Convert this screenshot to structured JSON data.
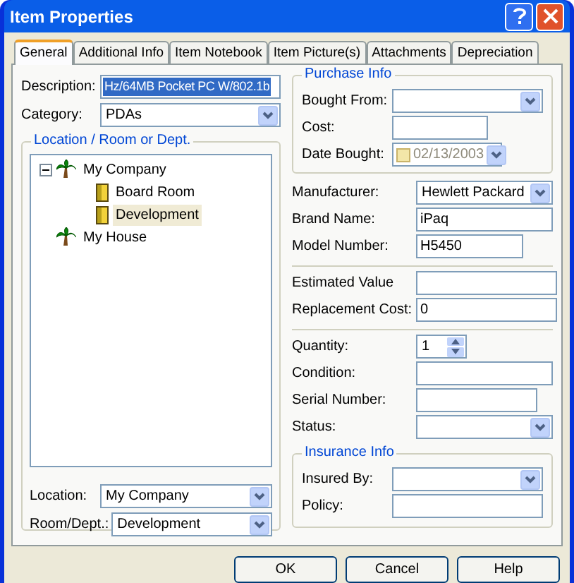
{
  "window": {
    "title": "Item Properties"
  },
  "tabs": [
    {
      "label": "General",
      "selected": true
    },
    {
      "label": "Additional Info",
      "selected": false
    },
    {
      "label": "Item Notebook",
      "selected": false
    },
    {
      "label": "Item Picture(s)",
      "selected": false
    },
    {
      "label": "Attachments",
      "selected": false
    },
    {
      "label": "Depreciation",
      "selected": false
    }
  ],
  "general": {
    "top_fields": [
      {
        "label": "Description:",
        "kind": "text",
        "value": "Hz/64MB Pocket PC W/802.1b",
        "selected": true
      },
      {
        "label": "Category:",
        "kind": "combo",
        "value": "PDAs"
      }
    ],
    "location_group": {
      "title": "Location / Room or Dept.",
      "tree": [
        {
          "label": "My Company",
          "kind": "site",
          "expanded": true,
          "selected": false,
          "children": [
            {
              "label": "Board Room",
              "kind": "room",
              "selected": false
            },
            {
              "label": "Development",
              "kind": "room",
              "selected": true
            }
          ]
        },
        {
          "label": "My House",
          "kind": "site",
          "selected": false
        }
      ],
      "fields": [
        {
          "label": "Location:",
          "kind": "combo",
          "value": "My Company"
        },
        {
          "label": "Room/Dept.:",
          "kind": "combo",
          "value": "Development"
        }
      ]
    },
    "purchase_info": {
      "title": "Purchase Info",
      "fields": [
        {
          "label": "Bought From:",
          "kind": "combo"
        },
        {
          "label": "Cost:",
          "kind": "text"
        },
        {
          "label": "Date Bought:",
          "kind": "date",
          "value": "02/13/2003",
          "disabled": true
        }
      ]
    },
    "sections": [
      [
        {
          "label": "Manufacturer:",
          "kind": "combo",
          "value": "Hewlett Packard"
        },
        {
          "label": "Brand Name:",
          "kind": "text",
          "value": "iPaq"
        },
        {
          "label": "Model Number:",
          "kind": "text",
          "value": "H5450"
        }
      ],
      [
        {
          "label": "Estimated Value",
          "kind": "text"
        },
        {
          "label": "Replacement Cost:",
          "kind": "text",
          "value": "0"
        }
      ],
      [
        {
          "label": "Quantity:",
          "kind": "spin",
          "value": "1"
        },
        {
          "label": "Condition:",
          "kind": "text"
        },
        {
          "label": "Serial Number:",
          "kind": "text"
        },
        {
          "label": "Status:",
          "kind": "combo"
        }
      ]
    ],
    "insurance_info": {
      "title": "Insurance Info",
      "fields": [
        {
          "label": "Insured By:",
          "kind": "combo"
        },
        {
          "label": "Policy:",
          "kind": "text"
        }
      ]
    }
  },
  "buttons": [
    "OK",
    "Cancel",
    "Help"
  ]
}
